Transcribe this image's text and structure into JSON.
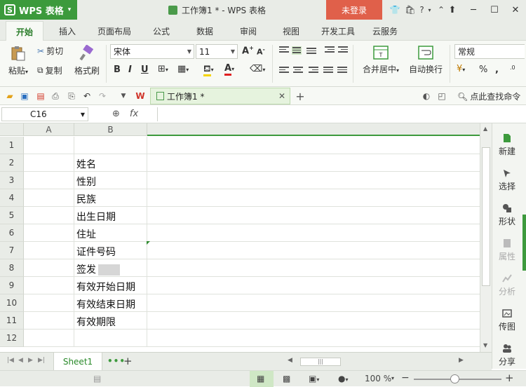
{
  "titlebar": {
    "app_name": "WPS 表格",
    "doc_title": "工作簿1 * - WPS 表格",
    "login_label": "未登录",
    "help_label": "?"
  },
  "ribbon_tabs": [
    "开始",
    "插入",
    "页面布局",
    "公式",
    "数据",
    "审阅",
    "视图",
    "开发工具",
    "云服务"
  ],
  "ribbon": {
    "paste_label": "粘贴",
    "cut_label": "剪切",
    "copy_label": "复制",
    "format_painter_label": "格式刷",
    "font_name": "宋体",
    "font_size": "11",
    "merge_center_label": "合并居中",
    "wrap_text_label": "自动换行",
    "number_format": "常规",
    "percent_label": "%"
  },
  "quick_access": {
    "doc_tab_label": "工作簿1 *",
    "find_command_label": "点此查找命令"
  },
  "formula_bar": {
    "name_box": "C16",
    "fx_label": "fx",
    "formula_value": ""
  },
  "grid": {
    "column_headers": [
      "A",
      "B"
    ],
    "row_headers": [
      "1",
      "2",
      "3",
      "4",
      "5",
      "6",
      "7",
      "8",
      "9",
      "10",
      "11",
      "12"
    ],
    "column_b_values": [
      "",
      "姓名",
      "性别",
      "民族",
      "出生日期",
      "住址",
      "证件号码",
      "签发",
      "有效开始日期",
      "有效结束日期",
      "有效期限",
      ""
    ]
  },
  "right_panel": {
    "items": [
      "新建",
      "选择",
      "形状",
      "属性",
      "分析",
      "传图",
      "分享"
    ]
  },
  "sheets": {
    "tabs": [
      "Sheet1"
    ]
  },
  "statusbar": {
    "zoom_label": "100 %"
  },
  "colors": {
    "brand_green": "#3c9a3c",
    "login_red": "#e0604a"
  }
}
